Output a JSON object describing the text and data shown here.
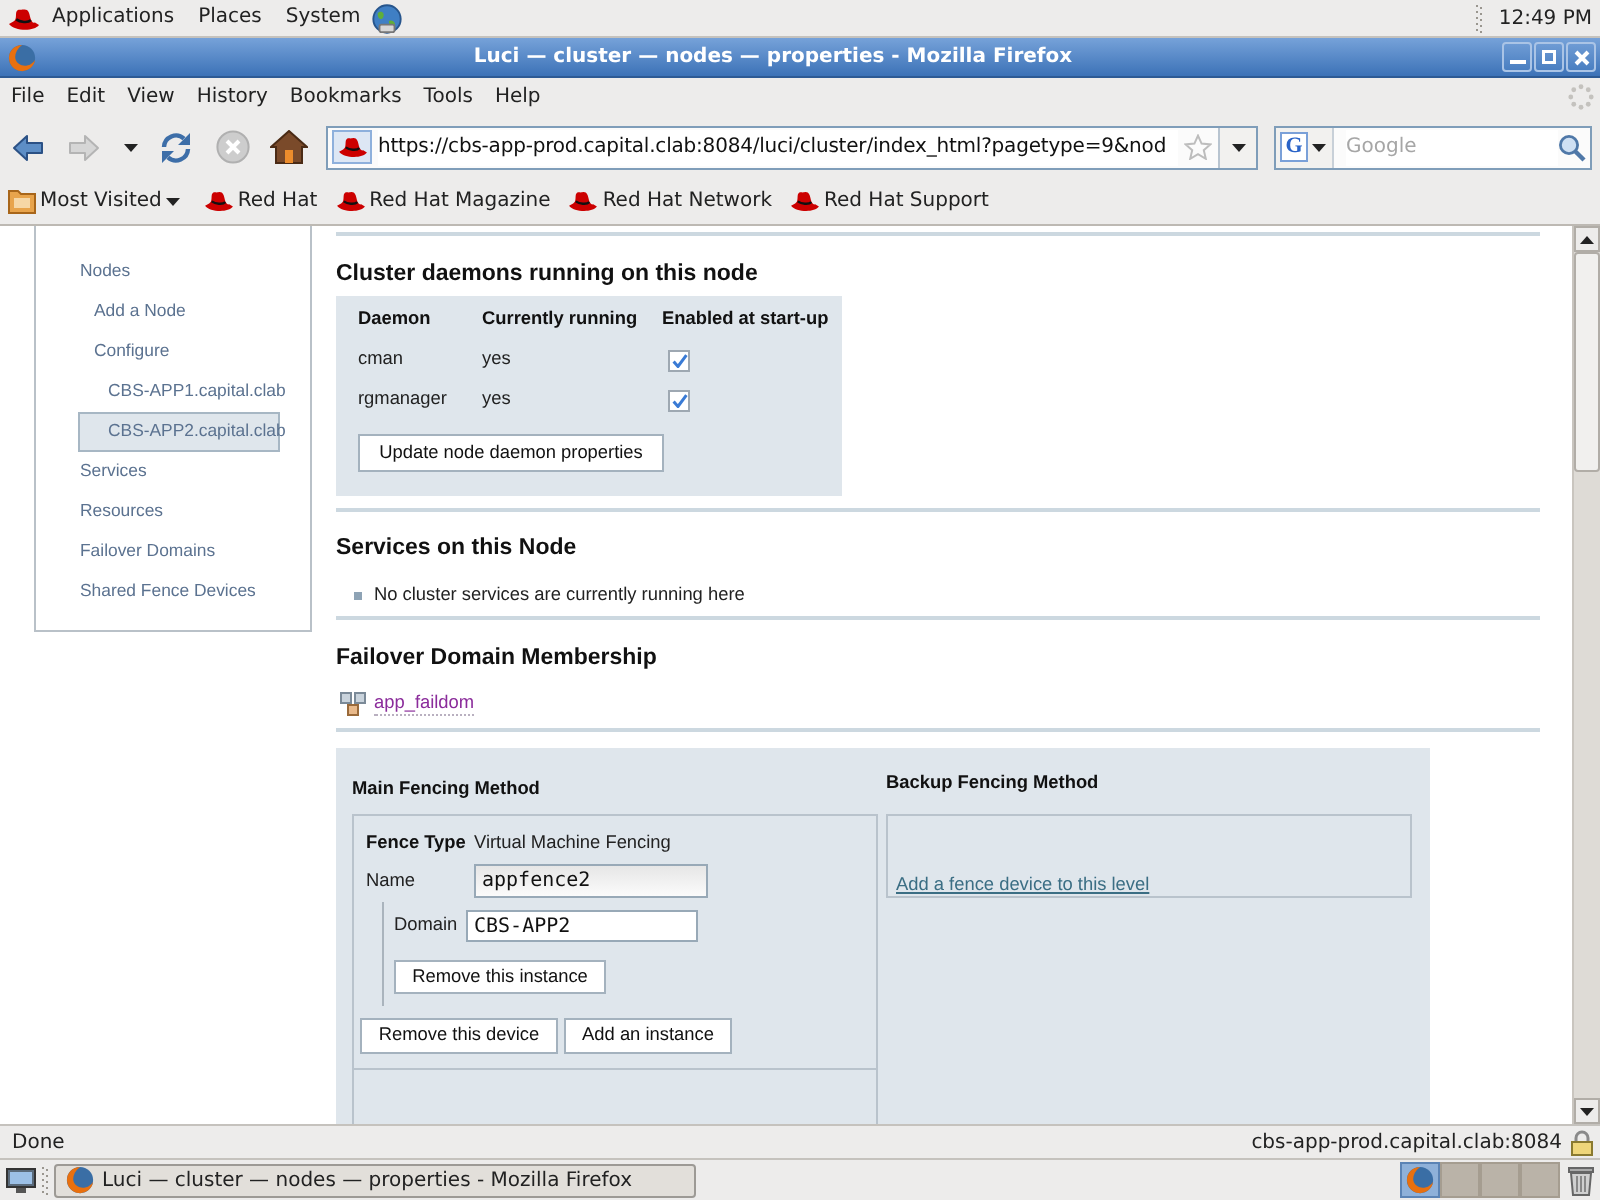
{
  "top_panel": {
    "menus": [
      "Applications",
      "Places",
      "System"
    ],
    "clock": "12:49 PM"
  },
  "window": {
    "title": "Luci — cluster — nodes — properties - Mozilla Firefox"
  },
  "menu_bar": [
    "File",
    "Edit",
    "View",
    "History",
    "Bookmarks",
    "Tools",
    "Help"
  ],
  "nav_buttons": [
    {
      "kind": "back",
      "disabled": false
    },
    {
      "kind": "forward",
      "disabled": true
    },
    {
      "kind": "history",
      "disabled": false
    },
    {
      "kind": "reload",
      "disabled": false
    },
    {
      "kind": "stop",
      "disabled": true
    },
    {
      "kind": "home",
      "disabled": false
    }
  ],
  "address_bar": {
    "url": "https://cbs-app-prod.capital.clab:8084/luci/cluster/index_html?pagetype=9&nod"
  },
  "search_bar": {
    "engine_letter": "G",
    "placeholder": "Google"
  },
  "bookmarks": [
    {
      "kind": "folder",
      "label": "Most Visited"
    },
    {
      "kind": "page",
      "label": "Red Hat"
    },
    {
      "kind": "page",
      "label": "Red Hat Magazine"
    },
    {
      "kind": "page",
      "label": "Red Hat Network"
    },
    {
      "kind": "page",
      "label": "Red Hat Support"
    }
  ],
  "sidebar": {
    "items": [
      {
        "label": "Nodes",
        "selected": false,
        "children": [
          {
            "label": "Add a Node",
            "selected": false
          },
          {
            "label": "Configure",
            "selected": false,
            "children": [
              {
                "label": "CBS-APP1.capital.clab",
                "selected": false
              },
              {
                "label": "CBS-APP2.capital.clab",
                "selected": true
              }
            ]
          }
        ]
      },
      {
        "label": "Services",
        "selected": false
      },
      {
        "label": "Resources",
        "selected": false
      },
      {
        "label": "Failover Domains",
        "selected": false
      },
      {
        "label": "Shared Fence Devices",
        "selected": false
      }
    ]
  },
  "daemons": {
    "heading": "Cluster daemons running on this node",
    "columns": [
      "Daemon",
      "Currently running",
      "Enabled at start-up"
    ],
    "rows": [
      {
        "daemon": "cman",
        "running": "yes",
        "enabled": true
      },
      {
        "daemon": "rgmanager",
        "running": "yes",
        "enabled": true
      }
    ],
    "button": "Update node daemon properties"
  },
  "services": {
    "heading": "Services on this Node",
    "items": [
      "No cluster services are currently running here"
    ]
  },
  "failover": {
    "heading": "Failover Domain Membership",
    "domains": [
      "app_faildom"
    ]
  },
  "fencing": {
    "main": {
      "heading": "Main Fencing Method",
      "devices": [
        {
          "fence_type_label": "Fence Type",
          "fence_type": "Virtual Machine Fencing",
          "name_label": "Name",
          "name": "appfence2",
          "instances": [
            {
              "domain_label": "Domain",
              "domain": "CBS-APP2",
              "remove_button": "Remove this instance"
            }
          ],
          "buttons": [
            "Remove this device",
            "Add an instance"
          ]
        }
      ]
    },
    "backup": {
      "heading": "Backup Fencing Method",
      "add_link": "Add a fence device to this level"
    }
  },
  "status_bar": {
    "text": "Done",
    "host": "cbs-app-prod.capital.clab:8084"
  },
  "taskbar": {
    "tasks": [
      {
        "label": "Luci — cluster — nodes — properties - Mozilla Firefox"
      }
    ],
    "workspaces": [
      {
        "selected": true,
        "has_window": true
      },
      {
        "selected": false,
        "has_window": false
      },
      {
        "selected": false,
        "has_window": false
      },
      {
        "selected": false,
        "has_window": false
      }
    ]
  }
}
